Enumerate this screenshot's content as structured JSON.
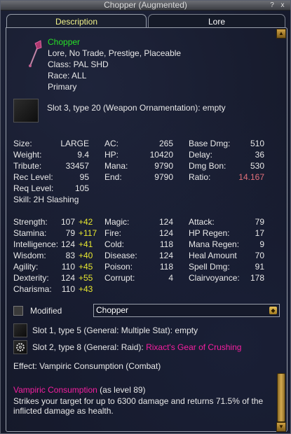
{
  "window": {
    "title": "Chopper (Augmented)",
    "help_label": "?",
    "close_label": "x"
  },
  "tabs": [
    {
      "label": "Description",
      "selected": true
    },
    {
      "label": "Lore",
      "selected": false
    }
  ],
  "item": {
    "name": "Chopper",
    "flags": "Lore, No Trade, Prestige, Placeable",
    "class": "Class: PAL SHD",
    "race": "Race: ALL",
    "slot": "Primary",
    "icon": "axe-icon"
  },
  "ornament_slot": "Slot 3, type 20 (Weapon Ornamentation): empty",
  "stats_left": [
    {
      "label": "Size:",
      "value": "LARGE"
    },
    {
      "label": "Weight:",
      "value": "9.4"
    },
    {
      "label": "Tribute:",
      "value": "33457"
    },
    {
      "label": "Rec Level:",
      "value": "95"
    },
    {
      "label": "Req Level:",
      "value": "105"
    }
  ],
  "skill": "Skill:   2H Slashing",
  "stats_mid": [
    {
      "label": "AC:",
      "value": "265"
    },
    {
      "label": "HP:",
      "value": "10420"
    },
    {
      "label": "Mana:",
      "value": "9790"
    },
    {
      "label": "End:",
      "value": "9790"
    }
  ],
  "stats_right": [
    {
      "label": "Base Dmg:",
      "value": "510"
    },
    {
      "label": "Delay:",
      "value": "36"
    },
    {
      "label": "Dmg Bon:",
      "value": "530"
    },
    {
      "label": "Ratio:",
      "value": "14.167"
    }
  ],
  "attributes": [
    {
      "label": "Strength:",
      "value": "107",
      "bonus": "+42"
    },
    {
      "label": "Stamina:",
      "value": "79",
      "bonus": "+117"
    },
    {
      "label": "Intelligence:",
      "value": "124",
      "bonus": "+41"
    },
    {
      "label": "Wisdom:",
      "value": "83",
      "bonus": "+40"
    },
    {
      "label": "Agility:",
      "value": "110",
      "bonus": "+45"
    },
    {
      "label": "Dexterity:",
      "value": "124",
      "bonus": "+55"
    },
    {
      "label": "Charisma:",
      "value": "110",
      "bonus": "+43"
    }
  ],
  "resists": [
    {
      "label": "Magic:",
      "value": "124"
    },
    {
      "label": "Fire:",
      "value": "124"
    },
    {
      "label": "Cold:",
      "value": "118"
    },
    {
      "label": "Disease:",
      "value": "124"
    },
    {
      "label": "Poison:",
      "value": "118"
    },
    {
      "label": "Corrupt:",
      "value": "4"
    }
  ],
  "combat": [
    {
      "label": "Attack:",
      "value": "79"
    },
    {
      "label": "HP Regen:",
      "value": "17"
    },
    {
      "label": "Mana Regen:",
      "value": "9"
    },
    {
      "label": "Heal Amount",
      "value": "70"
    },
    {
      "label": "Spell Dmg:",
      "value": "91"
    },
    {
      "label": "Clairvoyance:",
      "value": "178"
    }
  ],
  "modified": {
    "label": "Modified",
    "checked": false,
    "select_value": "Chopper"
  },
  "aug_slots": {
    "slot1": "Slot 1, type 5 (General: Multiple Stat): empty",
    "slot2_prefix": "Slot 2, type 8 (General: Raid):",
    "slot2_name": "Rixact's Gear of Crushing"
  },
  "effect": "Effect: Vampiric Consumption (Combat)",
  "spell": {
    "name": "Vampiric Consumption",
    "level": "(as level 89)",
    "desc_line1": "Strikes your target for up to 6300 damage and returns 71.5% of the",
    "desc_line2": "inflicted damage as health."
  },
  "colors": {
    "item_name": "#27e027",
    "aug_name": "#f51fa0",
    "ratio": "#e0707a",
    "bonus": "#e6e630",
    "tab_selected_text": "#f2f28a"
  }
}
